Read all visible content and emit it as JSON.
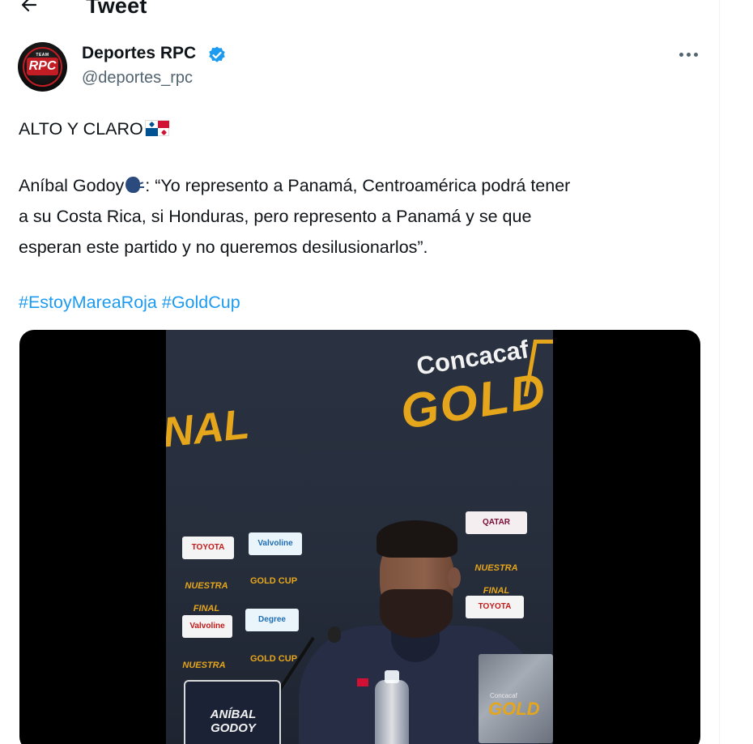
{
  "header": {
    "title": "Tweet",
    "back_icon": "arrow-left-icon"
  },
  "author": {
    "name": "Deportes RPC",
    "handle": "@deportes_rpc",
    "verified": true,
    "verified_color": "#1d9bf0",
    "avatar_text": "RPC",
    "avatar_top": "TEAM"
  },
  "tweet": {
    "line1": "ALTO Y CLARO",
    "line2_prefix": "Aníbal Godoy",
    "line2_suffix": ": “Yo represento a Panamá, Centroamérica podrá tener",
    "line3": "a su Costa Rica, si Honduras, pero represento a Panamá y se que",
    "line4": "esperan este partido y no queremos desilusionarlos”.",
    "hashtags": [
      "#EstoyMareaRoja",
      "#GoldCup"
    ],
    "emoji_flag": "flag-panama-icon",
    "emoji_speaking": "speaking-head-icon"
  },
  "media": {
    "sponsor_top": "Concacaf",
    "sponsor_main": "GOLD",
    "final_fragment": "NAL",
    "logos": {
      "toyota": "TOYOTA",
      "valvoline": "Valvoline",
      "qatar": "QATAR",
      "nuestra_final": "NUESTRA FINAL",
      "goldcup": "GOLD CUP",
      "degree": "Degree"
    },
    "nameplate_line1": "ANÍBAL",
    "nameplate_line2": "GODOY",
    "box_sub": "Concacaf",
    "box_text": "GOLD"
  },
  "colors": {
    "link": "#1d9bf0",
    "text": "#0f1419",
    "secondary": "#536471",
    "gold": "#e6a61c"
  }
}
